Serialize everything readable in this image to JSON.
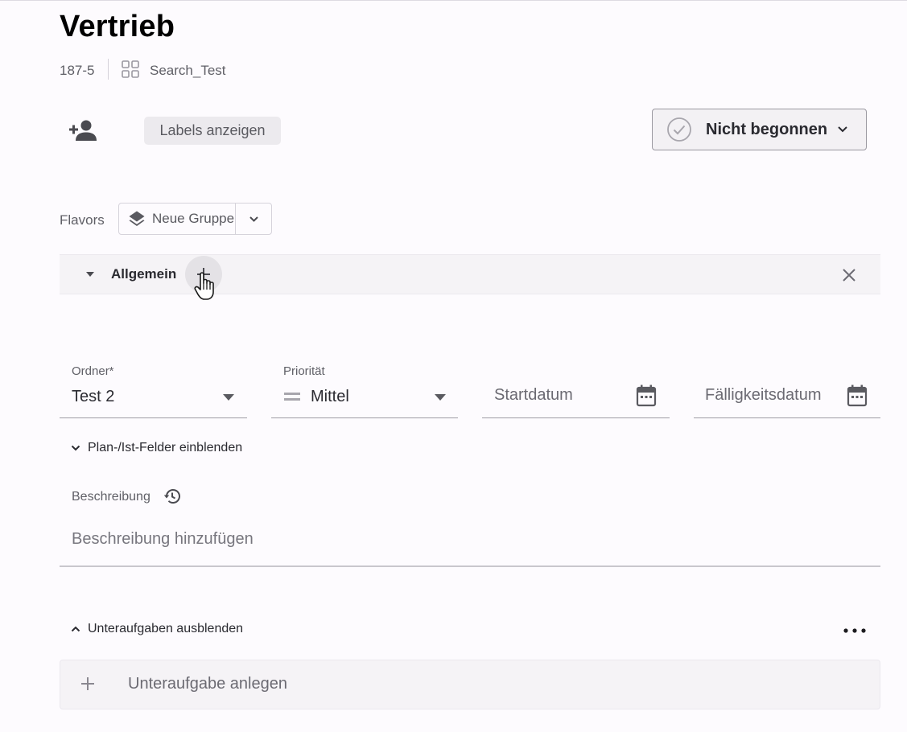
{
  "header": {
    "title": "Vertrieb",
    "task_id": "187-5",
    "project_name": "Search_Test",
    "project_icon": "grid-icon"
  },
  "toolbar": {
    "assign_icon": "person-add-icon",
    "labels_button": "Labels anzeigen",
    "status": "Nicht begonnen"
  },
  "flavors": {
    "label": "Flavors",
    "group_button": "Neue Gruppe",
    "group_icon": "layers-icon"
  },
  "section": {
    "title": "Allgemein"
  },
  "fields": {
    "folder": {
      "label": "Ordner*",
      "value": "Test 2"
    },
    "priority": {
      "label": "Priorität",
      "value": "Mittel",
      "icon": "medium-priority-icon"
    },
    "start_date": {
      "placeholder": "Startdatum"
    },
    "due_date": {
      "placeholder": "Fälligkeitsdatum"
    }
  },
  "plan_toggle": "Plan-/Ist-Felder einblenden",
  "description": {
    "label": "Beschreibung",
    "placeholder": "Beschreibung hinzufügen"
  },
  "subtasks": {
    "toggle": "Unteraufgaben ausblenden",
    "add_placeholder": "Unteraufgabe anlegen"
  },
  "colors": {
    "background": "#fdfbfe",
    "section_bar": "#f5f3f6",
    "text": "#2a2a30",
    "muted_text": "#5f5f66"
  }
}
